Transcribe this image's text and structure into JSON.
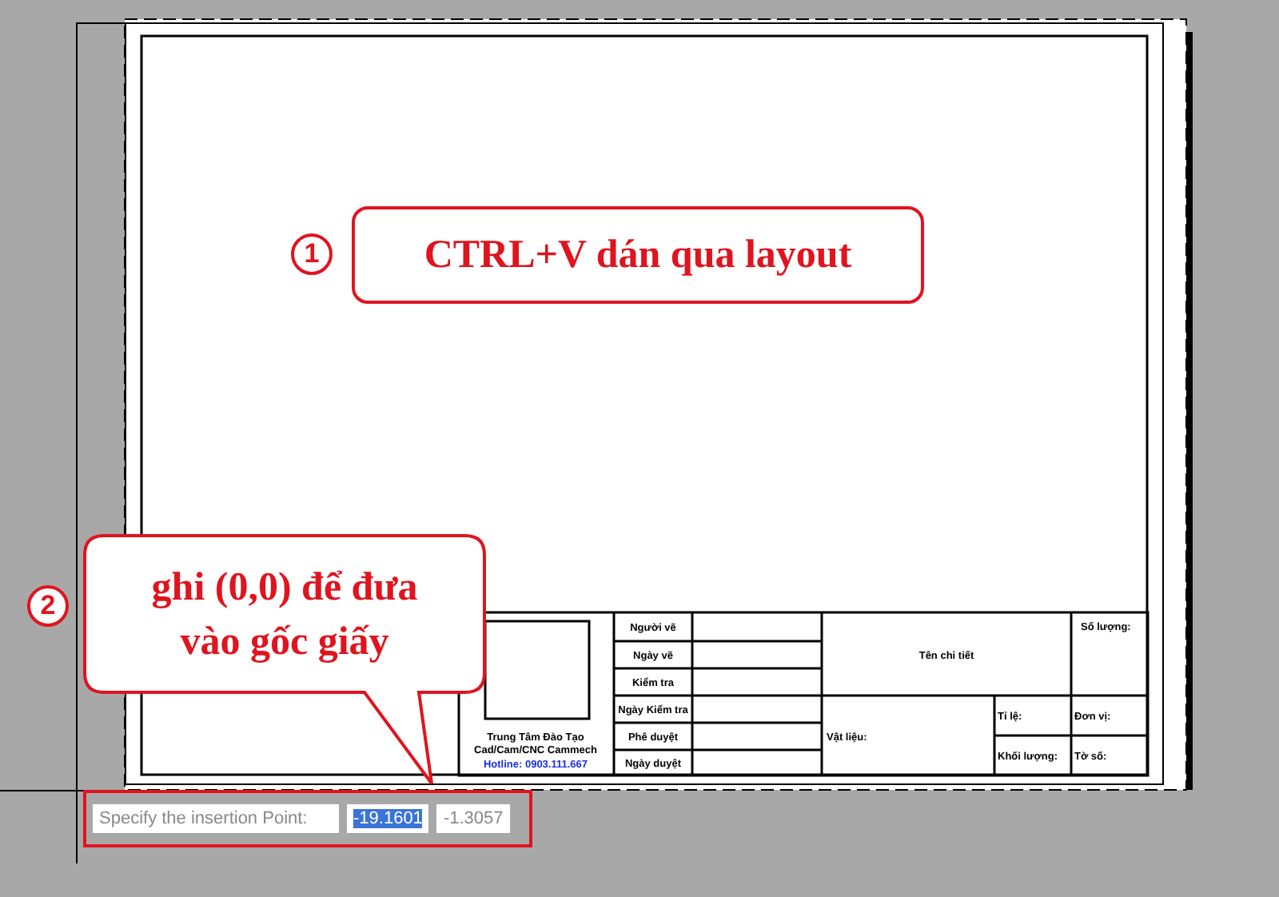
{
  "callouts": [
    {
      "number": "1",
      "lines": [
        "CTRL+V dán qua layout"
      ]
    },
    {
      "number": "2",
      "lines": [
        "ghi (0,0) để đưa",
        "vào gốc giấy"
      ]
    }
  ],
  "title_block": {
    "logo_caption": [
      "Trung Tâm Đào Tạo",
      "Cad/Cam/CNC Cammech"
    ],
    "hotline": "Hotline: 0903.111.667",
    "sign_rows": [
      "Người vẽ",
      "Ngày vẽ",
      "Kiểm tra",
      "Ngày Kiểm tra",
      "Phê duyệt",
      "Ngày duyệt"
    ],
    "part_name": "Tên chi tiết",
    "quantity": "Số lượng:",
    "material": "Vật liệu:",
    "scale": "Tỉ lệ:",
    "unit": "Đơn vị:",
    "mass": "Khối lượng:",
    "sheet": "Tờ số:"
  },
  "command_prompt": {
    "label": "Specify the insertion Point:",
    "fields": [
      {
        "value": "-19.1601",
        "selected": true
      },
      {
        "value": "-1.3057",
        "selected": false
      }
    ]
  }
}
